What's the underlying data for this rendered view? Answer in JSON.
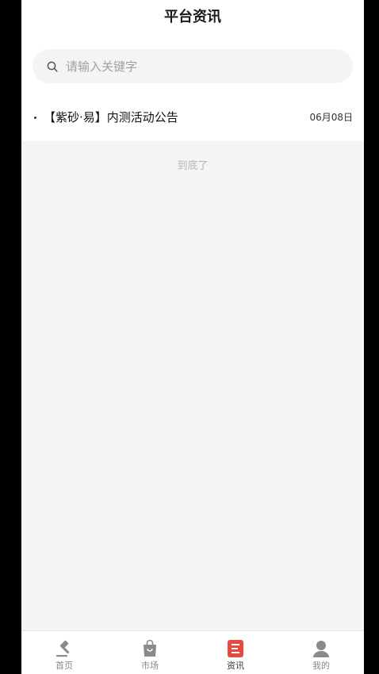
{
  "header": {
    "title": "平台资讯"
  },
  "search": {
    "placeholder": "请输入关键字",
    "value": ""
  },
  "news": [
    {
      "title": "【紫砂·易】内测活动公告",
      "date": "06月08日"
    }
  ],
  "list_end_text": "到底了",
  "tabbar": {
    "items": [
      {
        "label": "首页",
        "icon": "gavel-icon",
        "active": false
      },
      {
        "label": "市场",
        "icon": "shopping-bag-icon",
        "active": false
      },
      {
        "label": "资讯",
        "icon": "news-list-icon",
        "active": true
      },
      {
        "label": "我的",
        "icon": "user-profile-icon",
        "active": false
      }
    ]
  },
  "colors": {
    "accent": "#e84a3f",
    "icon_inactive": "#8a8a8a",
    "background": "#f5f5f7"
  }
}
